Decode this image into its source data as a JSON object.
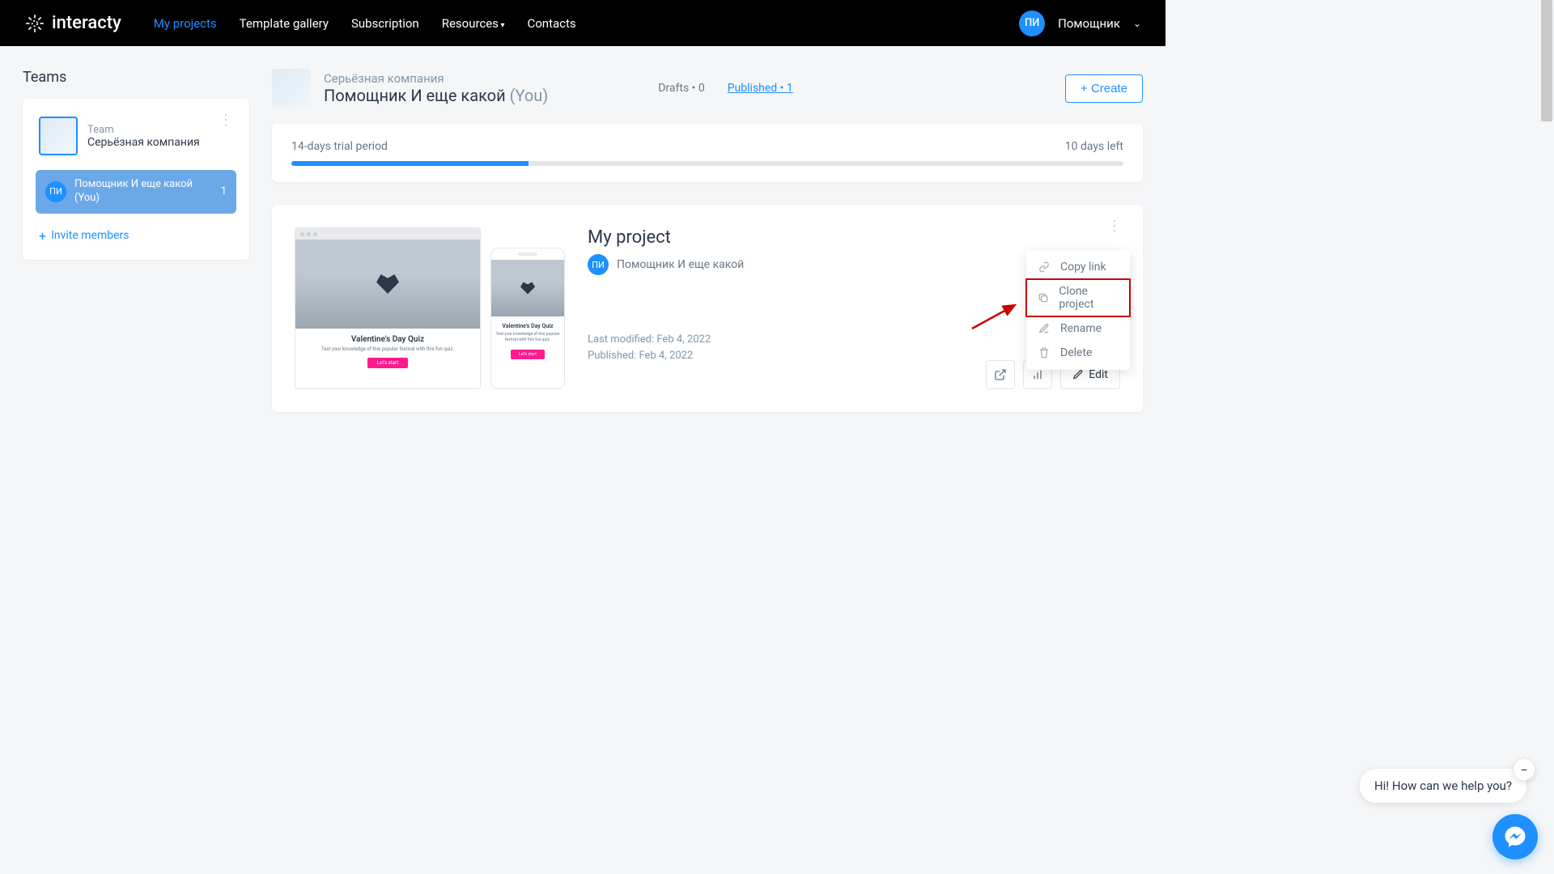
{
  "brand": "interacty",
  "nav": {
    "my_projects": "My projects",
    "template_gallery": "Template gallery",
    "subscription": "Subscription",
    "resources": "Resources",
    "contacts": "Contacts"
  },
  "user": {
    "initials": "ПИ",
    "name": "Помощник"
  },
  "sidebar": {
    "title": "Teams",
    "team_label": "Team",
    "team_name": "Серьёзная компания",
    "member_initials": "ПИ",
    "member_name": "Помощник И еще какой (You)",
    "member_count": "1",
    "invite": "Invite members"
  },
  "content_header": {
    "company": "Серьёзная компания",
    "person": "Помощник И еще какой",
    "you": "(You)",
    "drafts": "Drafts • 0",
    "published": "Published  • 1",
    "create": "+ Create"
  },
  "trial": {
    "label": "14-days trial period",
    "days_left": "10 days left"
  },
  "project": {
    "title": "My project",
    "author_initials": "ПИ",
    "author_name": "Помощник И еще какой",
    "modified": "Last modified: Feb 4, 2022",
    "published": "Published: Feb 4, 2022",
    "edit": "Edit",
    "preview_title": "Valentine's Day Quiz",
    "preview_sub": "Test your knowledge of this popular festival with this fun quiz.",
    "preview_btn": "Let's start"
  },
  "dropdown": {
    "copy_link": "Copy link",
    "clone": "Clone project",
    "rename": "Rename",
    "delete": "Delete"
  },
  "chat": {
    "greeting": "Hi! How can we help you?"
  }
}
